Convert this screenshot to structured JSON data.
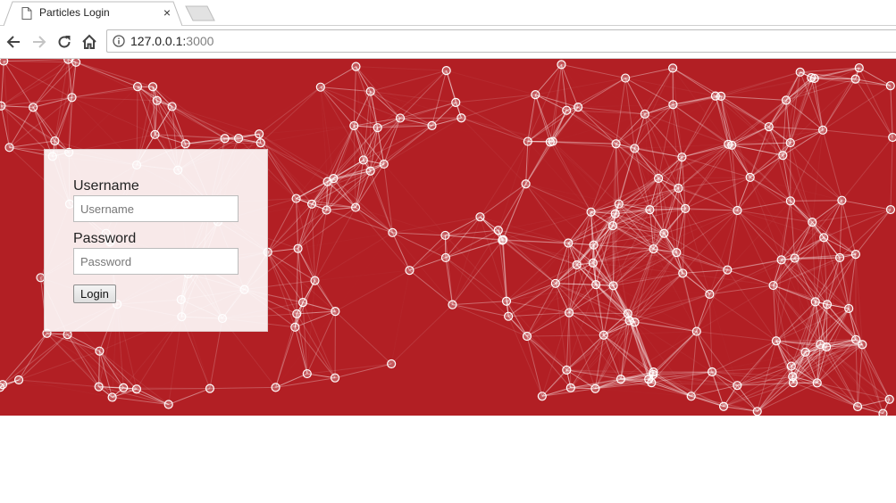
{
  "browser": {
    "tab_title": "Particles Login",
    "close_glyph": "×",
    "url_host": "127.0.0.1:",
    "url_port": "3000",
    "icons": [
      "page-icon",
      "close-icon",
      "back-arrow-icon",
      "forward-arrow-icon",
      "reload-icon",
      "home-icon",
      "info-icon"
    ]
  },
  "colors": {
    "background": "#b21f24",
    "particle": "#ffffff"
  },
  "login": {
    "username_label": "Username",
    "username_placeholder": "Username",
    "username_value": "",
    "password_label": "Password",
    "password_placeholder": "Password",
    "password_value": "",
    "button_label": "Login"
  }
}
